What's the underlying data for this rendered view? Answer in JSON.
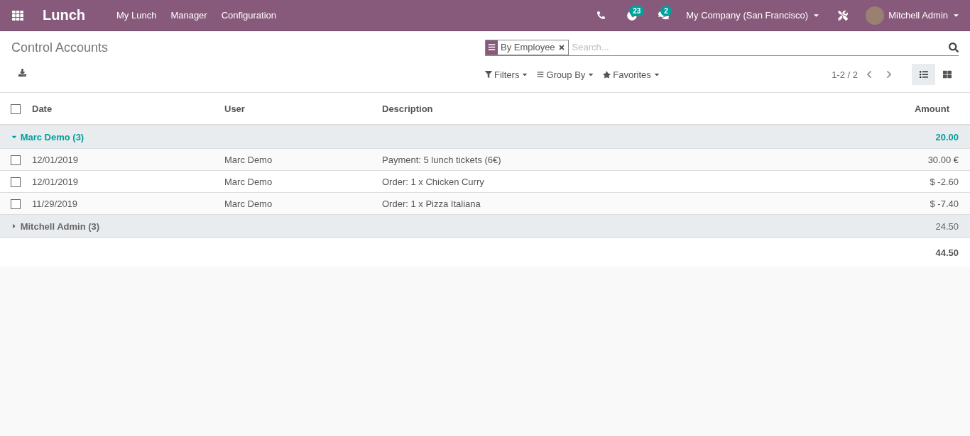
{
  "navbar": {
    "app": "Lunch",
    "menu": [
      "My Lunch",
      "Manager",
      "Configuration"
    ],
    "activity_count": "23",
    "message_count": "2",
    "company": "My Company (San Francisco)",
    "user": "Mitchell Admin"
  },
  "control_panel": {
    "title": "Control Accounts",
    "facet": "By Employee",
    "search_placeholder": "Search...",
    "filters": "Filters",
    "group_by": "Group By",
    "favorites": "Favorites",
    "pager": "1-2 / 2",
    "views": [
      {
        "kind": "list",
        "selected": true
      },
      {
        "kind": "kanban",
        "selected": false
      }
    ]
  },
  "table": {
    "select_all": false,
    "columns": [
      "Date",
      "User",
      "Description",
      "Amount"
    ],
    "groups": [
      {
        "label": "Marc Demo (3)",
        "total": "20.00",
        "expanded": true,
        "rows": [
          {
            "checked": false,
            "cells": [
              "12/01/2019",
              "Marc Demo",
              "Payment: 5 lunch tickets (6€)",
              "30.00 €"
            ]
          },
          {
            "checked": false,
            "cells": [
              "12/01/2019",
              "Marc Demo",
              "Order: 1 x Chicken Curry",
              "$ -2.60"
            ]
          },
          {
            "checked": false,
            "cells": [
              "11/29/2019",
              "Marc Demo",
              "Order: 1 x Pizza Italiana",
              "$ -7.40"
            ]
          }
        ]
      },
      {
        "label": "Mitchell Admin (3)",
        "total": "24.50",
        "expanded": false
      }
    ],
    "grand_total": "44.50"
  }
}
